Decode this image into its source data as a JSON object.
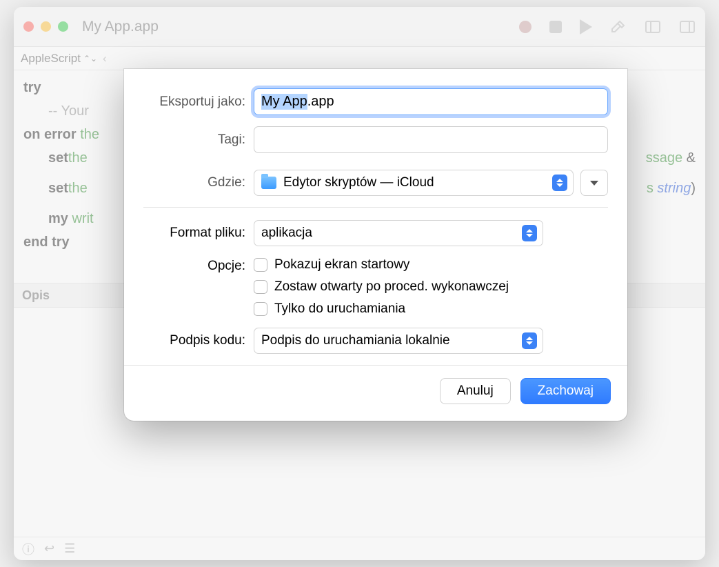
{
  "window": {
    "title": "My App.app",
    "language_selector": "AppleScript"
  },
  "code": {
    "l1_kw": "try",
    "l2_cmt": "-- Your",
    "l3_kw": "on error",
    "l3_var": " the",
    "l4_kw": "set",
    "l4_var": " the",
    "l4_tail1": "ssage",
    "l4_tail2": " &",
    "l5_kw": "set",
    "l5_var": " the",
    "l5_tail1": "s ",
    "l5_tail2": "string",
    "l5_tail3": ")",
    "l6_kw": "my",
    "l6_fn": " writ",
    "l7_kw": "end try"
  },
  "desc_bar": "Opis",
  "dialog": {
    "export_as_label": "Eksportuj jako:",
    "filename_selected": "My App",
    "filename_ext": ".app",
    "tags_label": "Tagi:",
    "tags_value": "",
    "where_label": "Gdzie:",
    "where_value": "Edytor skryptów — iCloud",
    "format_label": "Format pliku:",
    "format_value": "aplikacja",
    "options_label": "Opcje:",
    "opt1": "Pokazuj ekran startowy",
    "opt2": "Zostaw otwarty po proced. wykonawczej",
    "opt3": "Tylko do uruchamiania",
    "codesign_label": "Podpis kodu:",
    "codesign_value": "Podpis do uruchamiania lokalnie",
    "cancel": "Anuluj",
    "save": "Zachowaj"
  }
}
